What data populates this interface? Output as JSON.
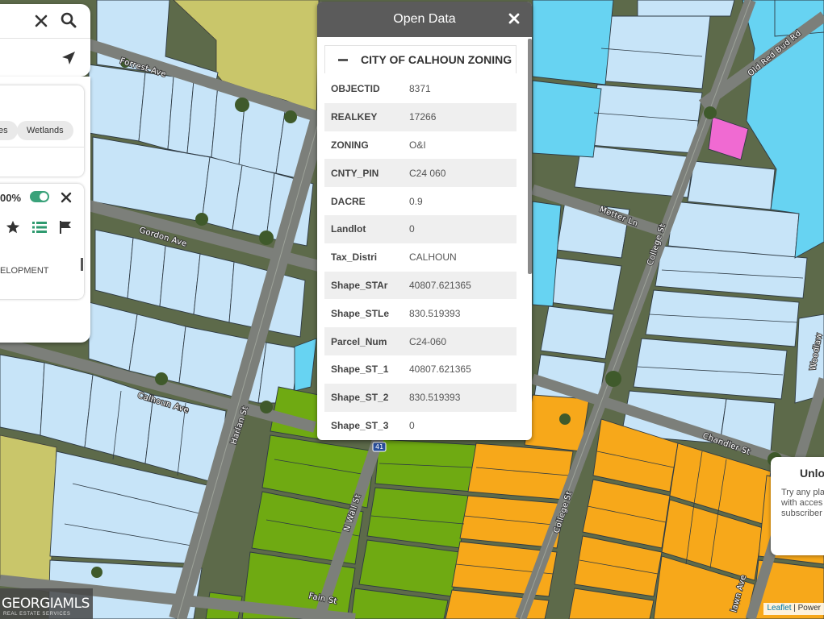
{
  "app": {
    "popup_title": "Open Data",
    "section_title": "CITY OF CALHOUN ZONING"
  },
  "attributes": [
    {
      "key": "OBJECTID",
      "value": "8371"
    },
    {
      "key": "REALKEY",
      "value": "17266"
    },
    {
      "key": "ZONING",
      "value": "O&I"
    },
    {
      "key": "CNTY_PIN",
      "value": "C24 060"
    },
    {
      "key": "DACRE",
      "value": "0.9"
    },
    {
      "key": "Landlot",
      "value": "0"
    },
    {
      "key": "Tax_Distri",
      "value": "CALHOUN"
    },
    {
      "key": "Shape_STAr",
      "value": "40807.621365"
    },
    {
      "key": "Shape_STLe",
      "value": "830.519393"
    },
    {
      "key": "Parcel_Num",
      "value": "C24-060"
    },
    {
      "key": "Shape_ST_1",
      "value": "40807.621365"
    },
    {
      "key": "Shape_ST_2",
      "value": "830.519393"
    },
    {
      "key": "Shape_ST_3",
      "value": "0"
    }
  ],
  "sidebar": {
    "chips": [
      "es",
      "Wetlands"
    ],
    "opacity": "00%",
    "layer_name": "ELOPMENT",
    "icons": [
      "close-icon",
      "search-icon",
      "locate-arrow-icon",
      "toggle-switch",
      "star-icon",
      "list-icon",
      "flag-icon"
    ]
  },
  "map": {
    "streets": {
      "forrest": "Forrest Ave",
      "gordon": "Gordon Ave",
      "calhoun": "Calhoun Ave",
      "harlan": "Harlan St",
      "metter": "Metter Ln",
      "college_north": "College St",
      "college_south": "College St",
      "chandler": "Chandler St",
      "wall": "N Wall St",
      "fain": "Fain St",
      "old_red_bud": "Old Red Bud Rd",
      "woodlawn": "Woodlaw",
      "lawn": "lawn Ave"
    },
    "route_badge": "41",
    "colors": {
      "residential": "#c7e4f8",
      "commercial_blue": "#67d3f2",
      "office_institutional": "#f7a81a",
      "green": "#6faa12",
      "olive": "#c9c66a",
      "pink": "#f06ad2",
      "toggle_on": "#3aa27a"
    }
  },
  "unlock": {
    "title": "Unlo",
    "lines": [
      "Try any pla",
      "with acces",
      "subscriber"
    ]
  },
  "attribution": {
    "leaflet": "Leaflet",
    "powered": "| Power"
  },
  "logo": {
    "text": "GEORGIAMLS",
    "sub": "REAL ESTATE SERVICES"
  }
}
